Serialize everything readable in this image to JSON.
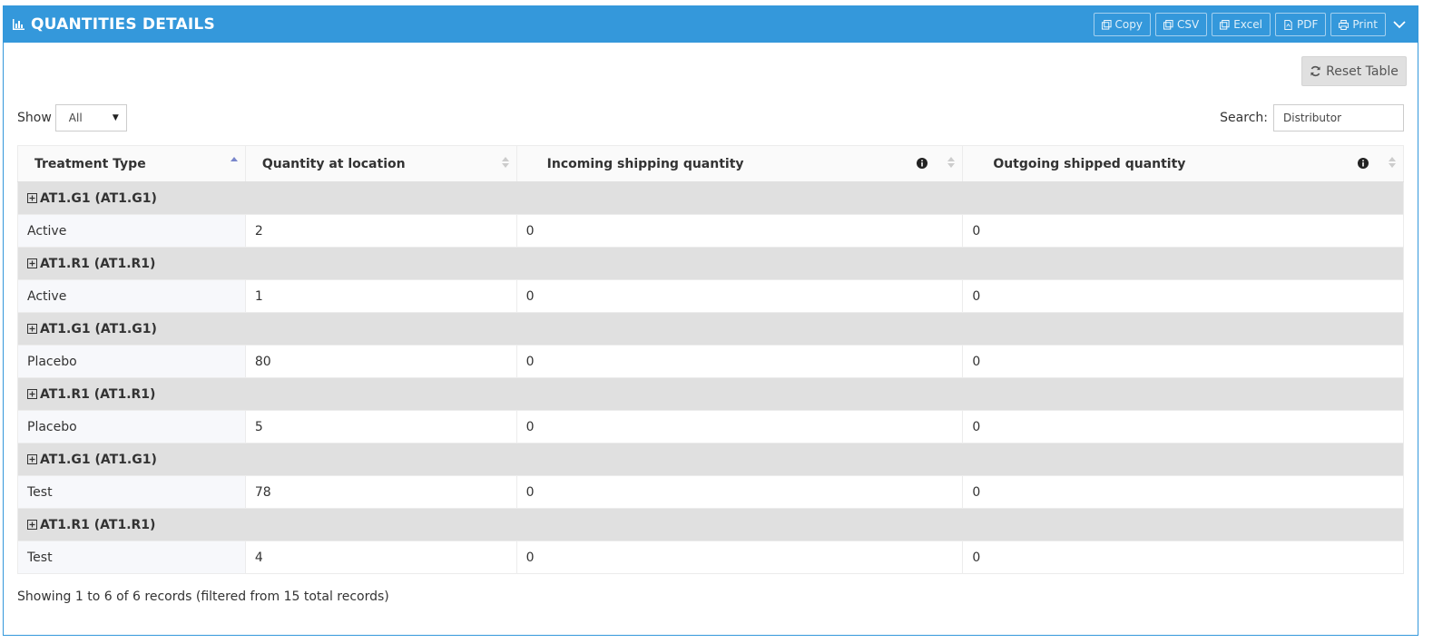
{
  "panel": {
    "title": "QUANTITIES DETAILS",
    "tools": [
      {
        "label": "Copy",
        "icon": "copy-icon"
      },
      {
        "label": "CSV",
        "icon": "copy-icon"
      },
      {
        "label": "Excel",
        "icon": "copy-icon"
      },
      {
        "label": "PDF",
        "icon": "pdf-file-icon"
      },
      {
        "label": "Print",
        "icon": "print-icon"
      }
    ]
  },
  "reset_label": "Reset Table",
  "show": {
    "label": "Show",
    "value": "All"
  },
  "search": {
    "label": "Search:",
    "value": "Distributor"
  },
  "table": {
    "headers": [
      "Treatment Type",
      "Quantity at location",
      "Incoming shipping quantity",
      "Outgoing shipped quantity"
    ],
    "rows": [
      {
        "group": "AT1.G1 (AT1.G1)",
        "cells": [
          "Active",
          "2",
          "0",
          "0"
        ]
      },
      {
        "group": "AT1.R1 (AT1.R1)",
        "cells": [
          "Active",
          "1",
          "0",
          "0"
        ]
      },
      {
        "group": "AT1.G1 (AT1.G1)",
        "cells": [
          "Placebo",
          "80",
          "0",
          "0"
        ]
      },
      {
        "group": "AT1.R1 (AT1.R1)",
        "cells": [
          "Placebo",
          "5",
          "0",
          "0"
        ]
      },
      {
        "group": "AT1.G1 (AT1.G1)",
        "cells": [
          "Test",
          "78",
          "0",
          "0"
        ]
      },
      {
        "group": "AT1.R1 (AT1.R1)",
        "cells": [
          "Test",
          "4",
          "0",
          "0"
        ]
      }
    ]
  },
  "footer": "Showing 1 to 6 of 6 records (filtered from 15 total records)"
}
